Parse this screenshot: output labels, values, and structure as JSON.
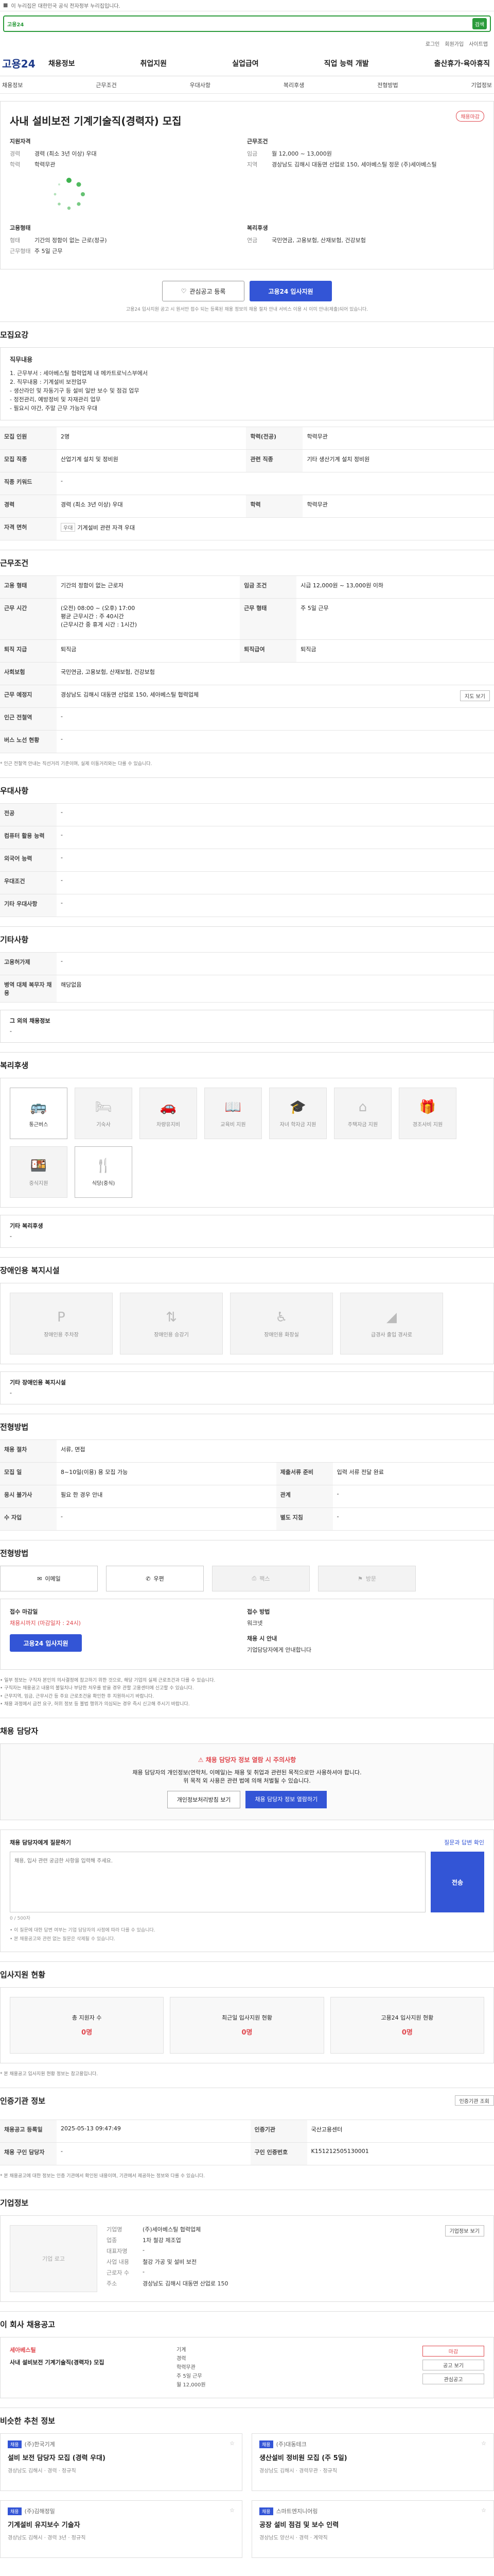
{
  "topstrip": {
    "text": "이 누리집은 대한민국 공식 전자정부 누리집입니다."
  },
  "search": {
    "logo": "고용24",
    "placeholder": "",
    "button": "검색"
  },
  "util": [
    "로그인",
    "회원가입",
    "사이트맵"
  ],
  "gnb": {
    "logo": "고용24",
    "menu": [
      "채용정보",
      "취업지원",
      "실업급여",
      "직업 능력 개발",
      "출산휴가·육아휴직"
    ],
    "sub": [
      "채용정보",
      "근무조건",
      "우대사항",
      "복리후생",
      "전형방법",
      "기업정보"
    ]
  },
  "job": {
    "company": "",
    "title": "사내 설비보전 기계기술직(경력자) 모집",
    "badge": "채용마감",
    "applicant": {
      "title": "지원자격",
      "rows": [
        {
          "k": "경력",
          "v": "경력 (최소 3년 이상) 우대"
        },
        {
          "k": "학력",
          "v": "학력무관"
        }
      ]
    },
    "condition": {
      "title": "근무조건",
      "rows": [
        {
          "k": "임금",
          "v": "월 12,000 ~ 13,000원"
        },
        {
          "k": "지역",
          "v": "경상남도 김해시 대동면 산업로 150, 세아베스틸 정문 (주)세아베스틸"
        }
      ]
    },
    "employ": {
      "title": "고용형태",
      "rows": [
        {
          "k": "형태",
          "v": "기간의 정함이 없는 근로(정규)"
        },
        {
          "k": "근무형태",
          "v": "주 5일 근무"
        }
      ]
    },
    "welfare": {
      "title": "복리후생",
      "rows": [
        {
          "k": "연금",
          "v": "국민연금, 고용보험, 산재보험, 건강보험"
        }
      ]
    }
  },
  "actions": {
    "scrap": "관심공고 등록",
    "apply": "고용24 입사지원",
    "note": "고용24 입사지원 공고 시 원서만 접수 되는 등록된 채용 정보의 채용 절차 안내 서비스 이용 시 이미 안내(제출)되어 있습니다."
  },
  "recruit": {
    "section": "모집요강",
    "box_title": "직무내용",
    "box_lines": [
      "1. 근무부서 : 세아베스틸 협력업체 내 메카트로닉스부에서",
      "2. 직무내용 : 기계설비 보전업무",
      "  - 생산라인 및 자동기구 등 설비 일반 보수 및 점검 업무",
      "  - 정전관리, 예방정비 및 자재관리 업무",
      "  - 필요시 야간, 주말 근무 가능자 우대"
    ],
    "rows": [
      [
        {
          "k": "모집 인원",
          "v": "2명"
        },
        {
          "k": "학력(전공)",
          "v": "학력무관"
        }
      ],
      [
        {
          "k": "모집 직종",
          "v": "산업기계 설치 및 정비원"
        },
        {
          "k": "관련 직종",
          "v": "기타 생산기계 설치 정비원"
        }
      ],
      [
        {
          "k": "직종 키워드",
          "v": "-"
        },
        {
          "k": "",
          "v": ""
        }
      ],
      [
        {
          "k": "경력",
          "v": "경력 (최소 3년 이상) 우대"
        },
        {
          "k": "학력",
          "v": "학력무관"
        }
      ],
      [
        {
          "k": "자격 면허",
          "v": "기계설비 관련 자격 우대"
        },
        {
          "k": "",
          "v": ""
        }
      ]
    ]
  },
  "work": {
    "section": "근무조건",
    "rows": [
      [
        {
          "k": "고용 형태",
          "v": "기간의 정함이 없는 근로자"
        },
        {
          "k": "임금 조건",
          "v": "시급 12,000원 ~ 13,000원 이하"
        }
      ],
      [
        {
          "k": "근무 시간",
          "v": "(오전) 08:00 ~ (오후) 17:00\n평균 근무시간 : 주 40시간\n(근무시간 중 휴게 시간 : 1시간)"
        },
        {
          "k": "근무 형태",
          "v": "주 5일 근무"
        }
      ],
      [
        {
          "k": "퇴직 지급",
          "v": "퇴직금"
        },
        {
          "k": "근무 예정지",
          "v": ""
        }
      ],
      [
        {
          "k": "사회보험",
          "v": "국민연금, 고용보험, 산재보험, 건강보험"
        },
        {
          "k": "퇴직급여",
          "v": "퇴직금"
        }
      ],
      [
        {
          "k": "근무 예정지",
          "v": "경상남도 김해시 대동면 산업로 150, 세아베스틸 협력업체"
        },
        {
          "k": "",
          "v": ""
        }
      ],
      [
        {
          "k": "인근 전철역",
          "v": "-"
        },
        {
          "k": "",
          "v": ""
        }
      ],
      [
        {
          "k": "버스 노선 현황",
          "v": "-"
        },
        {
          "k": "",
          "v": ""
        }
      ]
    ],
    "map_button": "지도 보기",
    "footnote": "* 인근 전철역 안내는 직선거리 기준이며, 실제 이동거리와는 다를 수 있습니다."
  },
  "pref": {
    "section": "우대사항",
    "rows": [
      {
        "k": "전공",
        "v": "-"
      },
      {
        "k": "컴퓨터 활용 능력",
        "v": "-"
      },
      {
        "k": "외국어 능력",
        "v": "-"
      },
      {
        "k": "우대조건",
        "v": "-"
      },
      {
        "k": "기타 우대사항",
        "v": "-"
      }
    ]
  },
  "other": {
    "section": "기타사항",
    "rows": [
      {
        "k": "고용허가제",
        "v": "-"
      },
      {
        "k": "병역 대체 복무자 채용",
        "v": "해당없음"
      }
    ],
    "etc_title": "그 외의 채용정보",
    "etc_val": "-"
  },
  "benefit": {
    "section": "복리후생",
    "items": [
      {
        "label": "통근버스",
        "icon": "bus-icon",
        "on": true
      },
      {
        "label": "기숙사",
        "icon": "bed-icon",
        "on": false
      },
      {
        "label": "차량유지비",
        "icon": "car-icon",
        "on": false
      },
      {
        "label": "교육비 지원",
        "icon": "book-icon",
        "on": false
      },
      {
        "label": "자녀 학자금 지원",
        "icon": "cap-icon",
        "on": false
      },
      {
        "label": "주택자금 지원",
        "icon": "house-icon",
        "on": false
      },
      {
        "label": "경조사비 지원",
        "icon": "gift-icon",
        "on": false
      },
      {
        "label": "중식지원",
        "icon": "meal-icon",
        "on": false
      },
      {
        "label": "식당(중식)",
        "icon": "food-icon",
        "on": true
      }
    ],
    "etc_title": "기타 복리후생",
    "etc_val": "-"
  },
  "disabled": {
    "section": "장애인용 복지시설",
    "items": [
      "장애인용 주차장",
      "장애인용 승강기",
      "장애인용 화장실",
      "급경사 출입 경사로"
    ],
    "etc_title": "기타 장애인용 복지시설",
    "etc_val": "-"
  },
  "process": {
    "section": "전형방법",
    "rows": [
      [
        {
          "k": "채용 절차",
          "v": "서류, 면접"
        },
        {
          "k": "",
          "v": ""
        }
      ],
      [
        {
          "k": "모집 일",
          "v": "8~10일(이용) 용 모집 가능"
        },
        {
          "k": "제출서류 준비",
          "v": "입력 서류 전달 완료"
        }
      ],
      [
        {
          "k": "응시 불가사",
          "v": "필요 한 경우 안내"
        },
        {
          "k": "관계",
          "v": "-"
        }
      ],
      [
        {
          "k": "수 자입",
          "v": "-"
        },
        {
          "k": "별도 지침",
          "v": "-"
        }
      ]
    ]
  },
  "contact": {
    "section": "전형방법",
    "buttons": [
      {
        "label": "이메일",
        "icon": "mail-icon",
        "off": false
      },
      {
        "label": "우편",
        "icon": "post-icon",
        "off": false
      },
      {
        "label": "팩스",
        "icon": "fax-icon",
        "off": true
      },
      {
        "label": "방문",
        "icon": "visit-icon",
        "off": true
      }
    ]
  },
  "apply": {
    "lab1": "접수 마감일",
    "val1": "채용시까지 (마감일자 : 24시)",
    "lab2": "접수 방법",
    "val2": "워크넷",
    "lab3": "채용 시 안내",
    "val3": "기업담당자에게 안내합니다",
    "button": "고용24 입사지원",
    "notes": [
      "• 일부 정보는 구직자 본인의 의사결정에 참고하기 위한 것으로, 해당 기업의 실제 근로조건과 다를 수 있습니다.",
      "• 구직자는 채용공고 내용의 불일치나 부당한 처우를 받을 경우 관할 고용센터에 신고할 수 있습니다.",
      "• 근무지역, 임금, 근무시간 등 주요 근로조건을 확인한 후 지원하시기 바랍니다.",
      "• 채용 과정에서 금전 요구, 허위 정보 등 불법 행위가 의심되는 경우 즉시 신고해 주시기 바랍니다."
    ]
  },
  "manager": {
    "section": "채용 담당자",
    "alert": "채용 담당자 정보 열람 시 주의사항",
    "text1": "채용 담당자의 개인정보(연락처, 이메일)는 채용 및 취업과 관련된 목적으로만 사용하셔야 합니다.",
    "text2": "위 목적 외 사용은 관련 법에 의해 처벌될 수 있습니다.",
    "btn1": "개인정보처리방침 보기",
    "btn2": "채용 담당자 정보 열람하기"
  },
  "ask": {
    "title": "채용 담당자에게 질문하기",
    "hint": "질문과 답변 확인",
    "placeholder": "채용, 입사 관련 궁금한 사항을 입력해 주세요.",
    "counter": "0 / 500자",
    "send": "전송",
    "notes": [
      "• 이 질문에 대한 답변 여부는 기업 담당자의 사정에 따라 다를 수 있습니다.",
      "• 본 채용공고와 관련 없는 질문은 삭제될 수 있습니다."
    ]
  },
  "stats": {
    "section": "입사지원 현황",
    "items": [
      {
        "label": "총 지원자 수",
        "num": "0명"
      },
      {
        "label": "최근일 입사지원 현황",
        "num": "0명"
      },
      {
        "label": "고용24 입사지원 현황",
        "num": "0명"
      }
    ],
    "note": "* 본 채용공고 입사지원 현황 정보는 참고용입니다."
  },
  "meta": {
    "section": "인증기관 정보",
    "btn": "인증기관 조회",
    "rows": [
      [
        {
          "k": "채용공고 등록일",
          "v": "2025-05-13 09:47:49"
        },
        {
          "k": "인증기관",
          "v": "국산고용센터"
        }
      ],
      [
        {
          "k": "채용 구인 담당자",
          "v": "-"
        },
        {
          "k": "구인 인증번호",
          "v": "K151212505130001"
        }
      ]
    ],
    "note": "* 본 채용공고에 대한 정보는 인증 기관에서 확인된 내용이며, 기관에서 제공하는 정보와 다를 수 있습니다."
  },
  "company": {
    "section": "기업정보",
    "logo_label": "기업 로고",
    "rows": [
      {
        "k": "기업명",
        "v": "(주)세아베스틸 협력업체"
      },
      {
        "k": "업종",
        "v": "1차 철강 제조업"
      },
      {
        "k": "대표자명",
        "v": "-"
      },
      {
        "k": "사업 내용",
        "v": "철강 가공 및 설비 보전"
      },
      {
        "k": "근로자 수",
        "v": "-"
      },
      {
        "k": "주소",
        "v": "경상남도 김해시 대동면 산업로 150"
      }
    ],
    "btn": "기업정보 보기"
  },
  "related": {
    "section": "이 회사 채용공고",
    "company": "세아베스틸",
    "title": "사내 설비보전 기계기술직(경력자) 모집",
    "rows": [
      "기계",
      "경력",
      "학력무관",
      "주 5일 근무",
      "월 12,000원"
    ],
    "status": "마감",
    "btn1": "공고 보기",
    "btn2": "관심공고"
  },
  "similar": {
    "section": "비슷한 추천 정보",
    "cards": [
      {
        "badge": "채용",
        "name": "(주)한국기계",
        "title": "설비 보전 담당자 모집 (경력 우대)",
        "meta": "경상남도 김해시 · 경력 · 정규직"
      },
      {
        "badge": "채용",
        "name": "(주)대동테크",
        "title": "생산설비 정비원 모집 (주 5일)",
        "meta": "경상남도 김해시 · 경력무관 · 정규직"
      },
      {
        "badge": "채용",
        "name": "(주)김해정밀",
        "title": "기계설비 유지보수 기술자",
        "meta": "경상남도 김해시 · 경력 3년 · 정규직"
      },
      {
        "badge": "채용",
        "name": "스마트엔지니어링",
        "title": "공장 설비 점검 및 보수 인력",
        "meta": "경상남도 양산시 · 경력 · 계약직"
      }
    ]
  }
}
